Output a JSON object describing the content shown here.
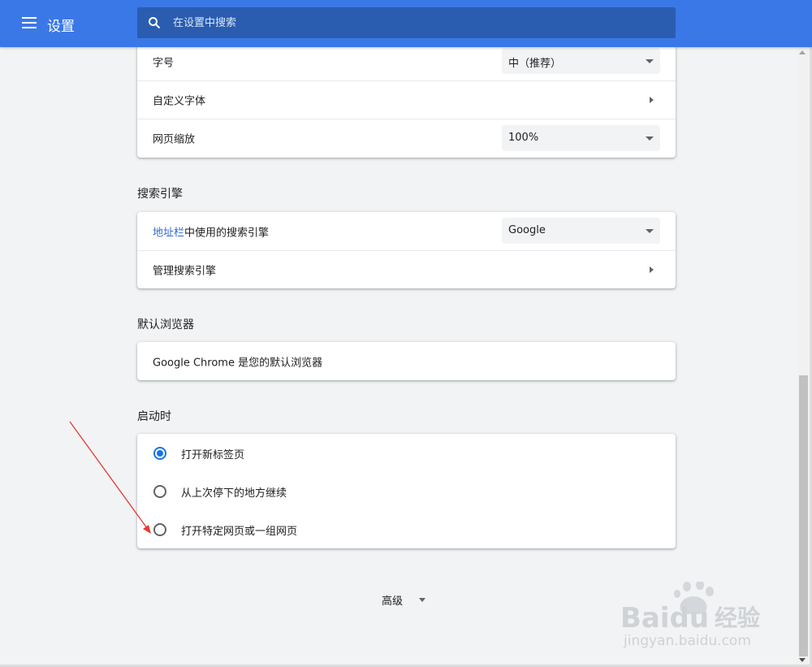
{
  "header": {
    "title": "设置",
    "search_placeholder": "在设置中搜索"
  },
  "appearance": {
    "font_size": {
      "label": "字号",
      "value": "中（推荐）"
    },
    "custom_fonts": {
      "label": "自定义字体"
    },
    "page_zoom": {
      "label": "网页缩放",
      "value": "100%"
    }
  },
  "search_engine": {
    "section_title": "搜索引擎",
    "engine": {
      "label_link": "地址栏",
      "label_rest": "中使用的搜索引擎",
      "value": "Google"
    },
    "manage": {
      "label": "管理搜索引擎"
    }
  },
  "default_browser": {
    "section_title": "默认浏览器",
    "status": "Google Chrome 是您的默认浏览器"
  },
  "on_startup": {
    "section_title": "启动时",
    "options": [
      {
        "label": "打开新标签页",
        "checked": true
      },
      {
        "label": "从上次停下的地方继续",
        "checked": false
      },
      {
        "label": "打开特定网页或一组网页",
        "checked": false
      }
    ]
  },
  "advanced": {
    "label": "高级"
  },
  "watermark": {
    "brand": "Baidu",
    "brand_cn": "经验",
    "url": "jingyan.baidu.com"
  },
  "colors": {
    "header": "#3b78e7",
    "accent": "#1a73e8",
    "link": "#3367d6",
    "annotation_arrow": "#e53935"
  }
}
